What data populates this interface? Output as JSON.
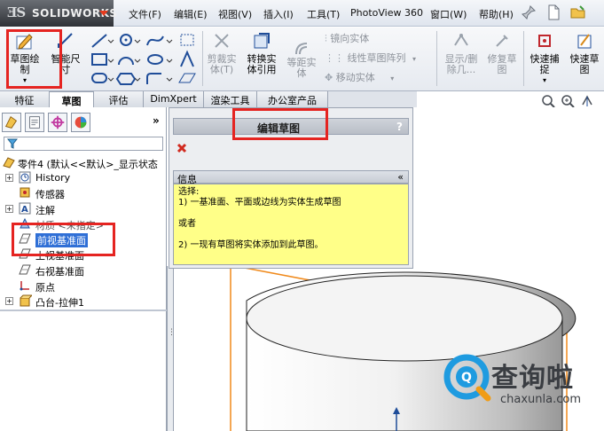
{
  "app": {
    "logo_ds": "ƎS",
    "logo_name": "SOLIDWORKS"
  },
  "menu": [
    "文件(F)",
    "编辑(E)",
    "视图(V)",
    "插入(I)",
    "工具(T)",
    "PhotoView 360",
    "窗口(W)",
    "帮助(H)"
  ],
  "toolbar": {
    "sketch_label_1": "草图绘",
    "sketch_label_2": "制",
    "smart_dim_1": "智能尺",
    "smart_dim_2": "寸",
    "trim_1": "剪裁实",
    "trim_2": "体(T)",
    "convert_1": "转换实",
    "convert_2": "体引用",
    "offset_1": "等距实",
    "offset_2": "体",
    "mirror": "镜向实体",
    "linear_pattern": "线性草图阵列",
    "move": "移动实体",
    "display_delete_1": "显示/删",
    "display_delete_2": "除几...",
    "repair_1": "修复草",
    "repair_2": "图",
    "quick_snap_1": "快速捕",
    "quick_snap_2": "捉",
    "quick_sketch_1": "快速草",
    "quick_sketch_2": "图"
  },
  "tabs": [
    "特征",
    "草图",
    "评估",
    "DimXpert",
    "渲染工具",
    "办公室产品"
  ],
  "active_tab": "草图",
  "tree": {
    "root": "零件4  (默认<<默认>_显示状态",
    "items": [
      "History",
      "传感器",
      "注解",
      "材质 <未指定>",
      "前视基准面",
      "上视基准面",
      "右视基准面",
      "原点",
      "凸台-拉伸1"
    ]
  },
  "property_manager": {
    "title": "编辑草图",
    "help": "?",
    "info_header": "信息",
    "collapse": "«",
    "info_lines": [
      "选择:",
      "1) 一基准面、平面或边线为实体生成草图",
      "",
      "或者",
      "",
      "2) 一现有草图将实体添加到此草图。"
    ]
  },
  "watermark": {
    "brand": "查询啦",
    "url": "chaxunla.com"
  },
  "colors": {
    "highlight": "#e52421",
    "info_bg": "#ffff88",
    "edge_orange": "#f08a1c"
  }
}
